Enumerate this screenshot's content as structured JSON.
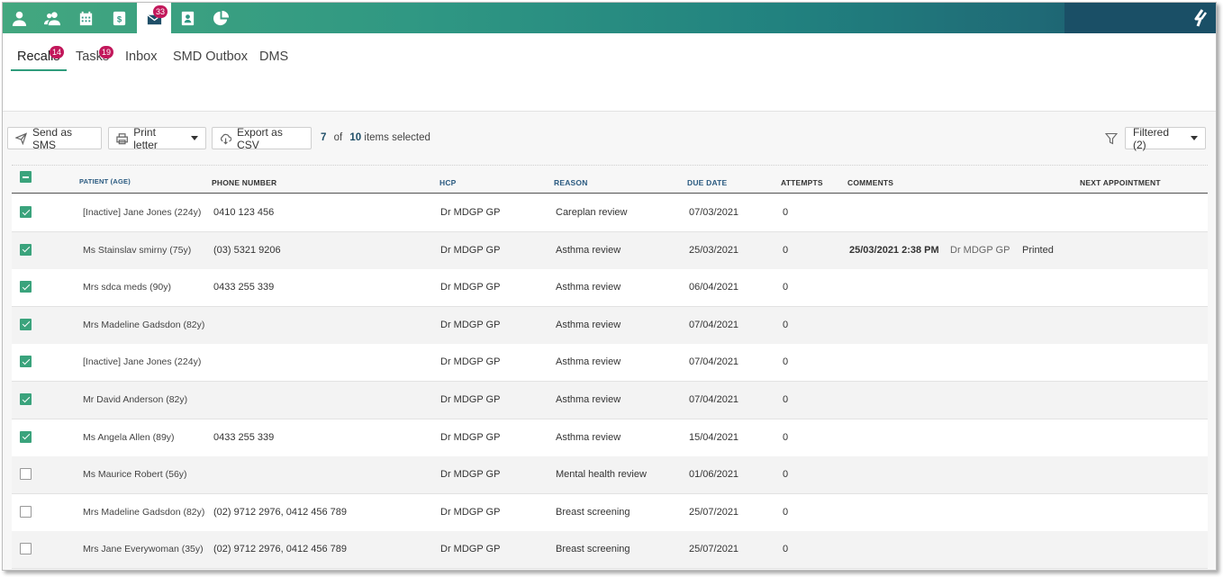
{
  "nav": {
    "icons": [
      "person-icon",
      "users-icon",
      "calendar-icon",
      "billing-icon",
      "mail-icon",
      "contacts-icon",
      "reports-icon"
    ],
    "mail_badge": "33",
    "active": "mail-icon",
    "brand": "brand-logo-icon"
  },
  "tabs": [
    {
      "label": "Recalls",
      "badge": "14",
      "active": true
    },
    {
      "label": "Tasks",
      "badge": "19",
      "active": false
    },
    {
      "label": "Inbox",
      "badge": "",
      "active": false
    },
    {
      "label": "SMD Outbox",
      "badge": "",
      "active": false
    },
    {
      "label": "DMS",
      "badge": "",
      "active": false
    }
  ],
  "toolbar": {
    "send_sms": "Send as SMS",
    "print_letter": "Print letter",
    "export_csv": "Export as CSV",
    "selected_count": "7",
    "of_text": "of",
    "total_count": "10",
    "items_selected": "items selected",
    "filter_label": "Filtered (2)"
  },
  "columns": {
    "patient": "PATIENT (AGE)",
    "phone": "PHONE NUMBER",
    "hcp": "HCP",
    "reason": "REASON",
    "due_date": "DUE DATE",
    "attempts": "ATTEMPTS",
    "comments": "COMMENTS",
    "next_appointment": "NEXT APPOINTMENT"
  },
  "rows": [
    {
      "checked": true,
      "patient": "[Inactive] Jane Jones (224y)",
      "phone": "0410 123 456",
      "hcp": "Dr MDGP GP",
      "reason": "Careplan review",
      "due": "07/03/2021",
      "attempts": "0",
      "comment_date": "",
      "comment_by": "",
      "comment_status": ""
    },
    {
      "checked": true,
      "patient": "Ms Stainslav smirny (75y)",
      "phone": "(03) 5321 9206",
      "hcp": "Dr MDGP GP",
      "reason": "Asthma review",
      "due": "25/03/2021",
      "attempts": "0",
      "comment_date": "25/03/2021 2:38 PM",
      "comment_by": "Dr MDGP GP",
      "comment_status": "Printed"
    },
    {
      "checked": true,
      "patient": "Mrs sdca meds (90y)",
      "phone": "0433 255 339",
      "hcp": "Dr MDGP GP",
      "reason": "Asthma review",
      "due": "06/04/2021",
      "attempts": "0",
      "comment_date": "",
      "comment_by": "",
      "comment_status": ""
    },
    {
      "checked": true,
      "patient": "Mrs Madeline Gadsdon (82y)",
      "phone": "",
      "hcp": "Dr MDGP GP",
      "reason": "Asthma review",
      "due": "07/04/2021",
      "attempts": "0",
      "comment_date": "",
      "comment_by": "",
      "comment_status": ""
    },
    {
      "checked": true,
      "patient": "[Inactive] Jane Jones (224y)",
      "phone": "",
      "hcp": "Dr MDGP GP",
      "reason": "Asthma review",
      "due": "07/04/2021",
      "attempts": "0",
      "comment_date": "",
      "comment_by": "",
      "comment_status": ""
    },
    {
      "checked": true,
      "patient": "Mr David Anderson (82y)",
      "phone": "",
      "hcp": "Dr MDGP GP",
      "reason": "Asthma review",
      "due": "07/04/2021",
      "attempts": "0",
      "comment_date": "",
      "comment_by": "",
      "comment_status": ""
    },
    {
      "checked": true,
      "patient": "Ms Angela Allen (89y)",
      "phone": "0433 255 339",
      "hcp": "Dr MDGP GP",
      "reason": "Asthma review",
      "due": "15/04/2021",
      "attempts": "0",
      "comment_date": "",
      "comment_by": "",
      "comment_status": ""
    },
    {
      "checked": false,
      "patient": "Ms Maurice Robert (56y)",
      "phone": "",
      "hcp": "Dr MDGP GP",
      "reason": "Mental health review",
      "due": "01/06/2021",
      "attempts": "0",
      "comment_date": "",
      "comment_by": "",
      "comment_status": ""
    },
    {
      "checked": false,
      "patient": "Mrs Madeline Gadsdon (82y)",
      "phone": "(02) 9712 2976, 0412 456 789",
      "hcp": "Dr MDGP GP",
      "reason": "Breast screening",
      "due": "25/07/2021",
      "attempts": "0",
      "comment_date": "",
      "comment_by": "",
      "comment_status": ""
    },
    {
      "checked": false,
      "patient": "Mrs Jane Everywoman (35y)",
      "phone": "(02) 9712 2976, 0412 456 789",
      "hcp": "Dr MDGP GP",
      "reason": "Breast screening",
      "due": "25/07/2021",
      "attempts": "0",
      "comment_date": "",
      "comment_by": "",
      "comment_status": ""
    }
  ],
  "colors": {
    "accent": "#3aa37c",
    "badge": "#c2185b",
    "header_blue": "#2a5a80"
  }
}
